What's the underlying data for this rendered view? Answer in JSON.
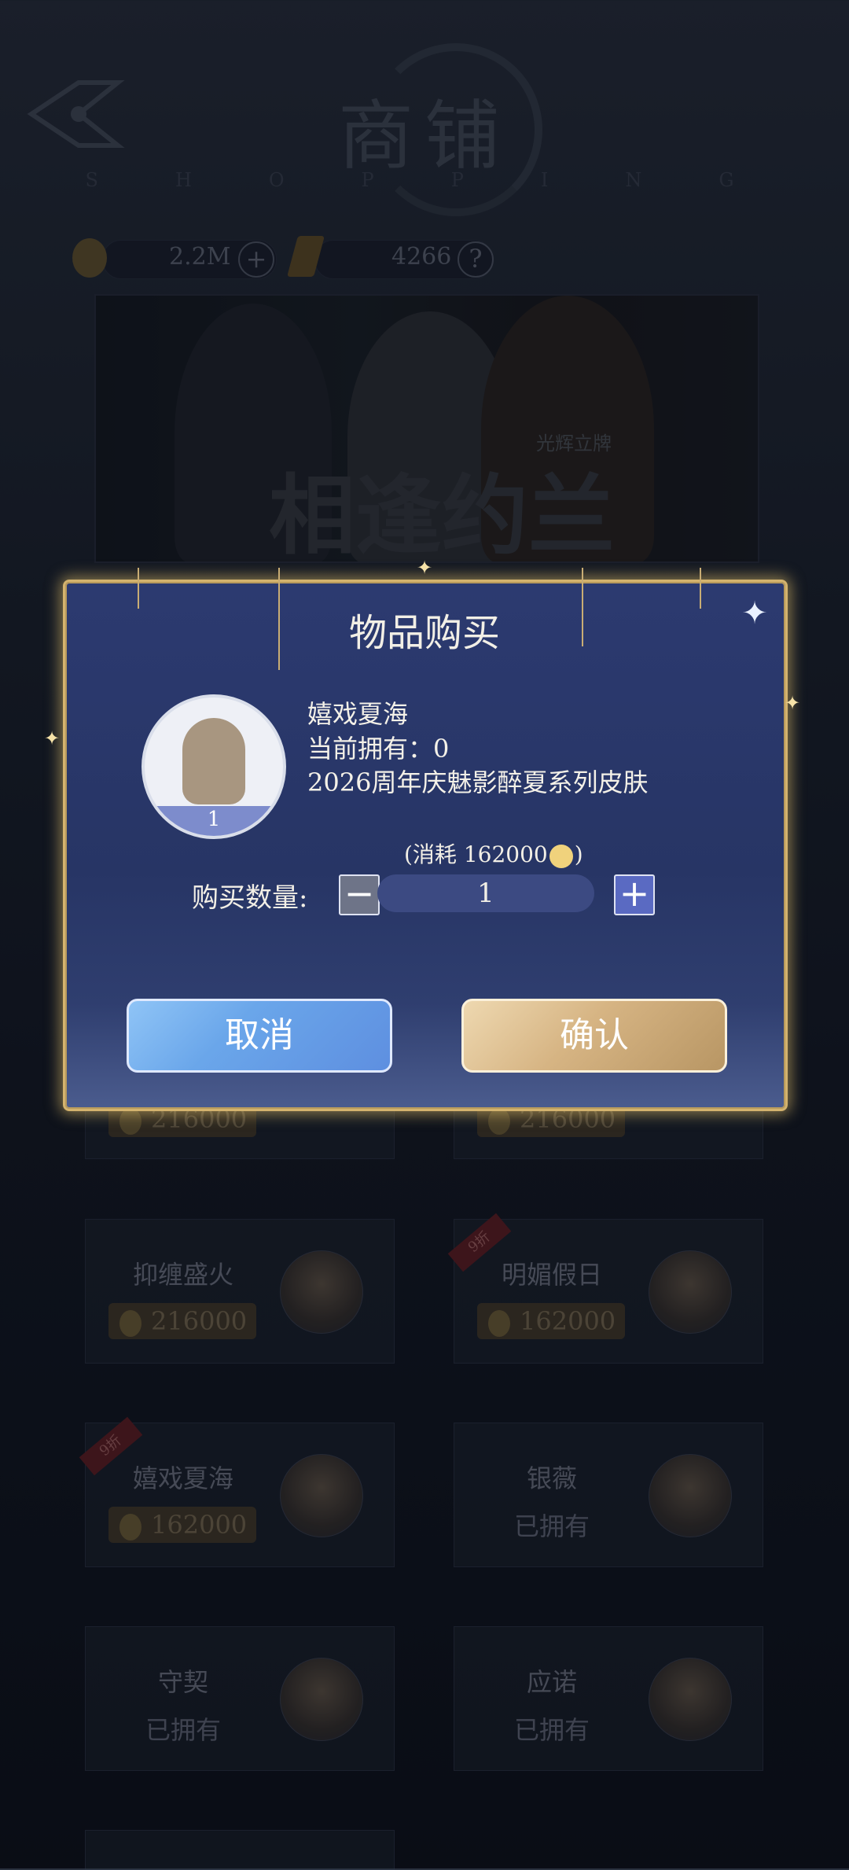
{
  "header": {
    "title": "商铺",
    "subtitle": "SHOPPING",
    "back_icon": "back-arrow-icon"
  },
  "currency": [
    {
      "icon": "gold-coin-icon",
      "value": "2.2M",
      "action": "+"
    },
    {
      "icon": "gem-icon",
      "value": "4266",
      "action": "?"
    }
  ],
  "banner": {
    "title": "相逢约兰",
    "subtitle": "光辉立牌"
  },
  "grid": [
    {
      "name": "抑缠盛火",
      "price": "216000",
      "discount": ""
    },
    {
      "name": "明媚假日",
      "price": "162000",
      "discount": "9折"
    },
    {
      "name": "嬉戏夏海",
      "price": "162000",
      "discount": "9折"
    },
    {
      "name": "银薇",
      "status": "已拥有"
    },
    {
      "name": "守契",
      "status": "已拥有"
    },
    {
      "name": "应诺",
      "status": "已拥有"
    },
    {
      "price": "216000"
    },
    {
      "price": "216000"
    }
  ],
  "modal": {
    "title": "物品购买",
    "item_name": "嬉戏夏海",
    "owned_text": "当前拥有：0",
    "description": "2026周年庆魅影醉夏系列皮肤",
    "avatar_count": "1",
    "cost_prefix": "(消耗 162000",
    "cost_suffix": ")",
    "quantity_label": "购买数量:",
    "quantity": "1",
    "minus": "−",
    "plus": "+",
    "cancel_label": "取消",
    "confirm_label": "确认",
    "close_icon": "close-star-icon"
  },
  "colors": {
    "accent_gold": "#d4b36e",
    "modal_bg": "#2c3a70",
    "cancel": "#6aa6ea",
    "confirm": "#d6b483"
  }
}
